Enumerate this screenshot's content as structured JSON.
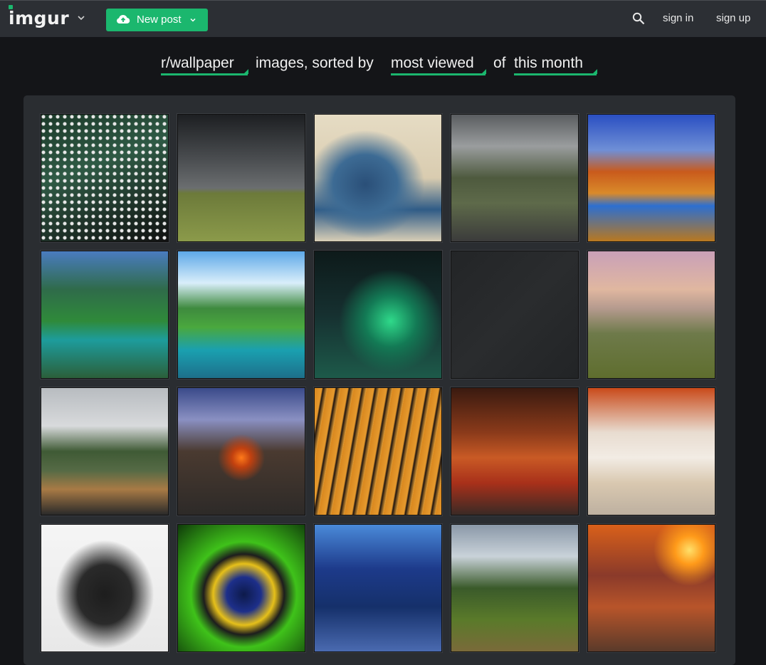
{
  "header": {
    "logo": "imgur",
    "new_post_label": "New post",
    "sign_in": "sign in",
    "sign_up": "sign up",
    "accent": "#1bb76e"
  },
  "heading": {
    "subreddit": "r/wallpaper",
    "text1": "images, sorted by",
    "sort": "most viewed",
    "text2": "of",
    "period": "this month"
  },
  "gallery": {
    "images": [
      {
        "subject": "cpu-pins"
      },
      {
        "subject": "storm-clouds-field"
      },
      {
        "subject": "great-wave"
      },
      {
        "subject": "airplane-hangar"
      },
      {
        "subject": "autumn-river"
      },
      {
        "subject": "mountain-lake"
      },
      {
        "subject": "waterfall-lake"
      },
      {
        "subject": "green-dark-creature"
      },
      {
        "subject": "dark-texture"
      },
      {
        "subject": "misty-hills"
      },
      {
        "subject": "dog-car-window"
      },
      {
        "subject": "rock-arch-sunset"
      },
      {
        "subject": "tiger"
      },
      {
        "subject": "red-forest"
      },
      {
        "subject": "park-bench-autumn"
      },
      {
        "subject": "black-puppy"
      },
      {
        "subject": "green-eye"
      },
      {
        "subject": "blue-dog"
      },
      {
        "subject": "forest-path"
      },
      {
        "subject": "rock-sunset"
      }
    ]
  }
}
